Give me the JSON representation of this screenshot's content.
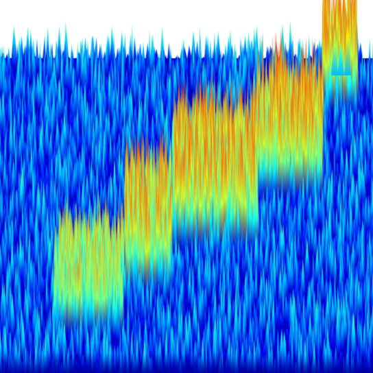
{
  "image": {
    "kind": "3d-surface-plot-rendering",
    "background_color": "#ffffff",
    "colormap": "jet",
    "colormap_stops": [
      "#00007f",
      "#0000ff",
      "#007fff",
      "#00ffff",
      "#7fff7f",
      "#ffff00",
      "#ff7f00",
      "#ff0000"
    ],
    "visible_text": []
  }
}
